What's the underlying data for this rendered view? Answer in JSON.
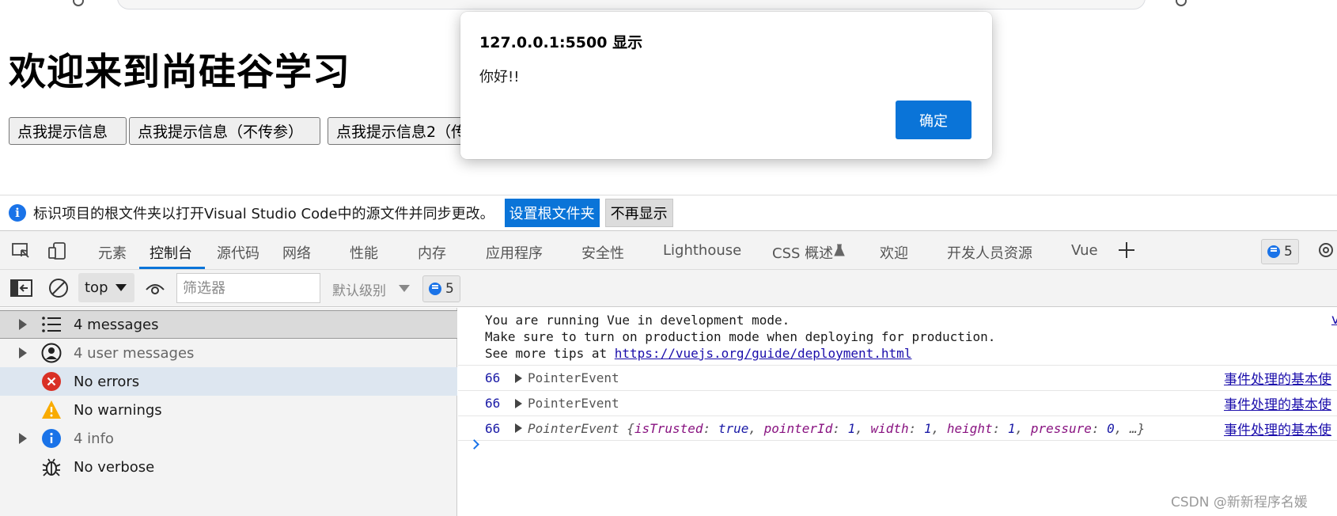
{
  "alert": {
    "title": "127.0.0.1:5500 显示",
    "message": "你好!!",
    "ok_label": "确定"
  },
  "page": {
    "title": "欢迎来到尚硅谷学习",
    "buttons": [
      "点我提示信息",
      "点我提示信息（不传参）",
      "点我提示信息2（传参）"
    ]
  },
  "infobar": {
    "text": "标识项目的根文件夹以打开Visual Studio Code中的源文件并同步更改。",
    "primary_label": "设置根文件夹",
    "secondary_label": "不再显示"
  },
  "devtools": {
    "tabs": [
      "元素",
      "控制台",
      "源代码",
      "网络",
      "性能",
      "内存",
      "应用程序",
      "安全性",
      "Lighthouse",
      "CSS 概述",
      "欢迎",
      "开发人员资源",
      "Vue"
    ],
    "active_tab": "控制台",
    "issues_count": "5",
    "accent_color": "#0a74d8"
  },
  "toolbar": {
    "context": "top",
    "filter_placeholder": "筛选器",
    "level": "默认级别",
    "issues_count": "5"
  },
  "sidebar": {
    "items": [
      {
        "label": "4 messages",
        "icon": "list-icon"
      },
      {
        "label": "4 user messages",
        "icon": "user-icon"
      },
      {
        "label": "No errors",
        "icon": "error-icon"
      },
      {
        "label": "No warnings",
        "icon": "warning-icon"
      },
      {
        "label": "4 info",
        "icon": "info-icon"
      },
      {
        "label": "No verbose",
        "icon": "bug-icon"
      }
    ]
  },
  "console": {
    "vue_line1": "You are running Vue in development mode.",
    "vue_line2": "Make sure to turn on production mode when deploying for production.",
    "vue_line3_prefix": "See more tips at ",
    "vue_link": "https://vuejs.org/guide/deployment.html",
    "vue_source": "v",
    "logs": [
      {
        "num": "66",
        "text": "PointerEvent",
        "source": "事件处理的基本使"
      },
      {
        "num": "66",
        "text": "PointerEvent",
        "source": "事件处理的基本使"
      },
      {
        "num": "66",
        "text": "PointerEvent",
        "source": "事件处理的基本使"
      }
    ],
    "expanded": {
      "k1": "isTrusted",
      "v1": "true",
      "k2": "pointerId",
      "v2": "1",
      "k3": "width",
      "v3": "1",
      "k4": "height",
      "v4": "1",
      "k5": "pressure",
      "v5": "0",
      "tail": ", …}"
    }
  },
  "watermark": "CSDN @新新程序名媛"
}
